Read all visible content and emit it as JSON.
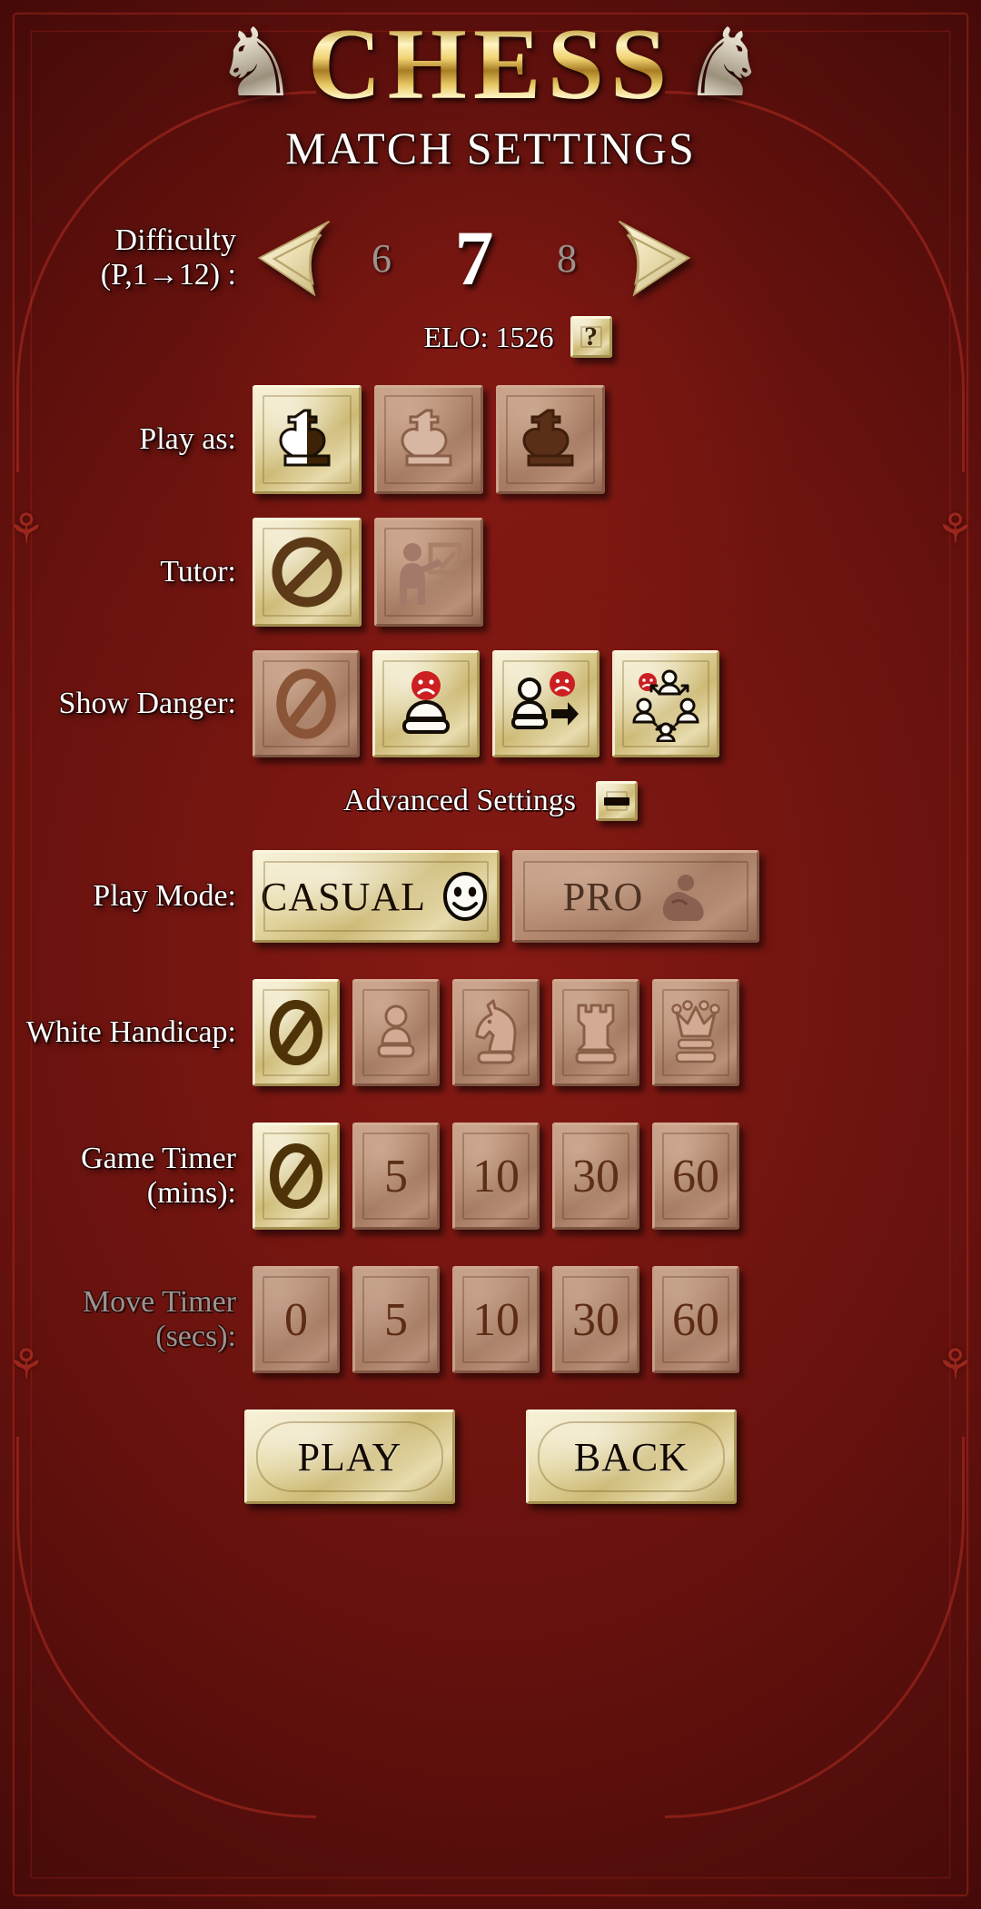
{
  "header": {
    "title": "CHESS",
    "subtitle": "MATCH SETTINGS",
    "left_knight_icon": "knight-icon",
    "right_knight_icon": "knight-icon"
  },
  "difficulty": {
    "label_line1": "Difficulty",
    "label_line2": "(P,1→12) :",
    "prev_value": "6",
    "current_value": "7",
    "next_value": "8",
    "left_arrow_icon": "arrow-left-icon",
    "right_arrow_icon": "arrow-right-icon",
    "elo_text": "ELO: 1526",
    "help_label": "?"
  },
  "play_as": {
    "label": "Play as:",
    "options": [
      {
        "name": "random",
        "icon": "king-random-icon",
        "selected": true
      },
      {
        "name": "white",
        "icon": "king-white-icon",
        "selected": false
      },
      {
        "name": "black",
        "icon": "king-black-icon",
        "selected": false
      }
    ]
  },
  "tutor": {
    "label": "Tutor:",
    "options": [
      {
        "name": "off",
        "icon": "no-entry-icon",
        "selected": true
      },
      {
        "name": "on",
        "icon": "teacher-icon",
        "selected": false
      }
    ]
  },
  "show_danger": {
    "label": "Show Danger:",
    "options": [
      {
        "name": "none",
        "icon": "no-entry-icon",
        "selected": false
      },
      {
        "name": "threatened-piece",
        "icon": "pawn-sad-icon",
        "selected": true
      },
      {
        "name": "attack-arrow",
        "icon": "pawn-arrow-icon",
        "selected": true
      },
      {
        "name": "all-threats",
        "icon": "multi-threat-icon",
        "selected": true
      }
    ]
  },
  "advanced": {
    "label": "Advanced Settings",
    "toggle_state": "expanded",
    "toggle_icon": "minus-icon"
  },
  "play_mode": {
    "label": "Play Mode:",
    "options": [
      {
        "name": "casual",
        "text": "CASUAL",
        "icon": "smiley-icon",
        "selected": true
      },
      {
        "name": "pro",
        "text": "PRO",
        "icon": "muscle-icon",
        "selected": false
      }
    ]
  },
  "white_handicap": {
    "label": "White Handicap:",
    "options": [
      {
        "name": "none",
        "icon": "no-entry-icon",
        "selected": true
      },
      {
        "name": "pawn",
        "icon": "pawn-icon",
        "selected": false
      },
      {
        "name": "knight",
        "icon": "knight-piece-icon",
        "selected": false
      },
      {
        "name": "rook",
        "icon": "rook-icon",
        "selected": false
      },
      {
        "name": "queen",
        "icon": "queen-icon",
        "selected": false
      }
    ]
  },
  "game_timer": {
    "label_line1": "Game Timer",
    "label_line2": "(mins):",
    "options": [
      {
        "name": "off",
        "text": "",
        "icon": "no-entry-icon",
        "selected": true
      },
      {
        "name": "5",
        "text": "5",
        "icon": "",
        "selected": false
      },
      {
        "name": "10",
        "text": "10",
        "icon": "",
        "selected": false
      },
      {
        "name": "30",
        "text": "30",
        "icon": "",
        "selected": false
      },
      {
        "name": "60",
        "text": "60",
        "icon": "",
        "selected": false
      }
    ]
  },
  "move_timer": {
    "label_line1": "Move Timer",
    "label_line2": "(secs):",
    "disabled": true,
    "options": [
      {
        "name": "0",
        "text": "0",
        "selected": false
      },
      {
        "name": "5",
        "text": "5",
        "selected": false
      },
      {
        "name": "10",
        "text": "10",
        "selected": false
      },
      {
        "name": "30",
        "text": "30",
        "selected": false
      },
      {
        "name": "60",
        "text": "60",
        "selected": false
      }
    ]
  },
  "footer": {
    "play_label": "PLAY",
    "back_label": "BACK"
  },
  "colors": {
    "wood_background": "#7a120e",
    "tile_selected": "#e4d7a2",
    "tile_unselected": "#b78c73",
    "gold_title": "#f0d373",
    "text_white": "#ffffff",
    "text_disabled": "#9a9490",
    "danger_red": "#cc1f22"
  }
}
